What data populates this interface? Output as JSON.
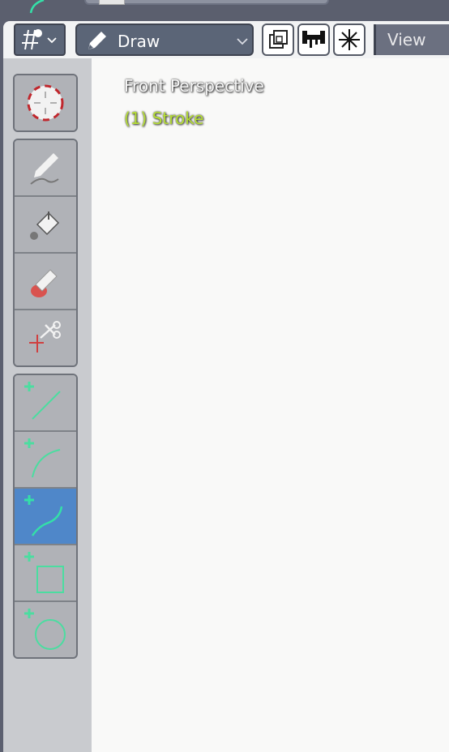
{
  "header": {
    "mode_icon": "gpencil-mode-icon",
    "tool_label": "Draw",
    "tool_icon": "pencil-icon",
    "buttons": [
      "duplicate-icon",
      "weights-icon",
      "snowflake-icon"
    ],
    "view_label": "View"
  },
  "toolbar": {
    "groups": [
      {
        "tools": [
          {
            "name": "cursor",
            "icon": "cursor-icon"
          }
        ]
      },
      {
        "tools": [
          {
            "name": "draw",
            "icon": "pencil-draw-icon"
          },
          {
            "name": "fill",
            "icon": "fill-bucket-icon"
          },
          {
            "name": "erase",
            "icon": "eraser-icon"
          },
          {
            "name": "cutter",
            "icon": "scissors-icon"
          }
        ]
      },
      {
        "tools": [
          {
            "name": "line",
            "icon": "line-icon"
          },
          {
            "name": "arc",
            "icon": "arc-icon"
          },
          {
            "name": "curve",
            "icon": "curve-icon",
            "active": true
          },
          {
            "name": "box",
            "icon": "box-icon"
          },
          {
            "name": "circle",
            "icon": "circle-icon"
          }
        ]
      }
    ]
  },
  "viewport": {
    "title": "Front Perspective",
    "object": "(1) Stroke"
  },
  "colors": {
    "accent": "#4f87c9",
    "object_label": "#b6df33",
    "shape_green": "#4bdda0"
  }
}
